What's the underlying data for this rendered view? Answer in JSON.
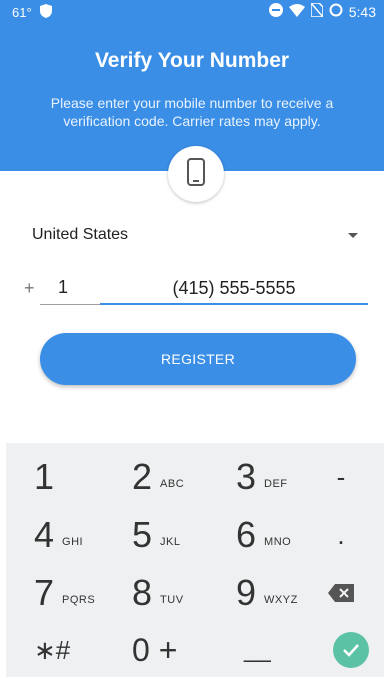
{
  "status_bar": {
    "temperature": "61°",
    "time": "5:43"
  },
  "header": {
    "title": "Verify Your Number",
    "subtitle": "Please enter your mobile number to receive a verification code. Carrier rates may apply."
  },
  "country": {
    "selected": "United States"
  },
  "phone": {
    "prefix": "+",
    "country_code": "1",
    "number": "(415) 555-5555"
  },
  "register_label": "REGISTER",
  "keypad": {
    "rows": [
      [
        {
          "d": "1",
          "l": ""
        },
        {
          "d": "2",
          "l": "ABC"
        },
        {
          "d": "3",
          "l": "DEF"
        },
        {
          "d": "-",
          "l": ""
        }
      ],
      [
        {
          "d": "4",
          "l": "GHI"
        },
        {
          "d": "5",
          "l": "JKL"
        },
        {
          "d": "6",
          "l": "MNO"
        },
        {
          "d": ".",
          "l": ""
        }
      ],
      [
        {
          "d": "7",
          "l": "PQRS"
        },
        {
          "d": "8",
          "l": "TUV"
        },
        {
          "d": "9",
          "l": "WXYZ"
        },
        {
          "d": "",
          "l": ""
        }
      ],
      [
        {
          "d": "∗#",
          "l": ""
        },
        {
          "d": "0 +",
          "l": ""
        },
        {
          "d": "__",
          "l": ""
        },
        {
          "d": "",
          "l": ""
        }
      ]
    ]
  },
  "colors": {
    "primary": "#3a8ee6",
    "confirm": "#5bc2a6"
  },
  "icons": [
    "phone-icon",
    "shield-icon",
    "dnd-icon",
    "wifi-icon",
    "no-sim-icon",
    "sync-icon",
    "backspace-icon",
    "check-icon"
  ]
}
